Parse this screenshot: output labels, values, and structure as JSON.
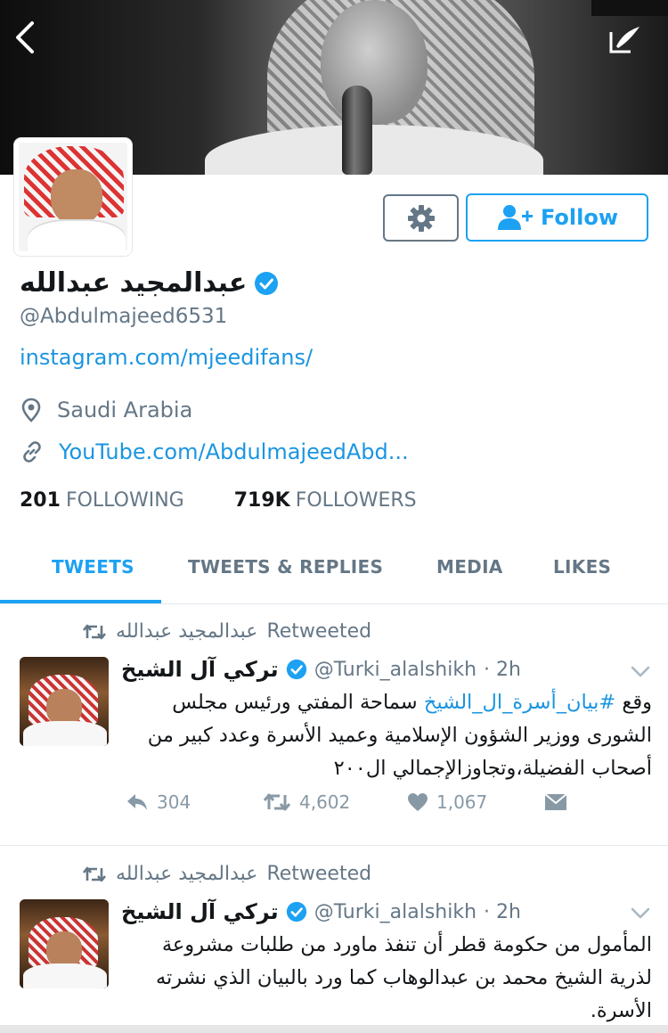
{
  "profile": {
    "name": "عبدالمجيد عبدالله",
    "handle": "@Abdulmajeed6531",
    "bio_link": "instagram.com/mjeedifans/",
    "location": "Saudi Arabia",
    "website": "YouTube.com/AbdulmajeedAbd...",
    "following_count": "201",
    "following_label": "FOLLOWING",
    "followers_count": "719K",
    "followers_label": "FOLLOWERS"
  },
  "actions": {
    "follow_label": "Follow"
  },
  "tabs": [
    {
      "label": "TWEETS",
      "active": true
    },
    {
      "label": "TWEETS & REPLIES",
      "active": false
    },
    {
      "label": "MEDIA",
      "active": false
    },
    {
      "label": "LIKES",
      "active": false
    }
  ],
  "tweets": [
    {
      "retweeted_by": "عبدالمجيد عبدالله",
      "retweeted_label": "Retweeted",
      "author_name": "تركي آل الشيخ",
      "author_handle": "@Turki_alalshikh",
      "time": "· 2h",
      "text_prefix": "وقع ",
      "hashtag": "#بيان_أسرة_ال_الشيخ",
      "text_rest": " سماحة المفتي ورئيس مجلس الشورى ووزير الشؤون الإسلامية وعميد الأسرة وعدد كبير من أصحاب الفضيلة،وتجاوزالإجمالي ال٢٠٠",
      "replies": "304",
      "retweets": "4,602",
      "likes": "1,067"
    },
    {
      "retweeted_by": "عبدالمجيد عبدالله",
      "retweeted_label": "Retweeted",
      "author_name": "تركي آل الشيخ",
      "author_handle": "@Turki_alalshikh",
      "time": "· 2h",
      "text": "المأمول من حكومة قطر أن تنفذ ماورد من طلبات مشروعة لذرية الشيخ محمد بن عبدالوهاب كما ورد بالبيان الذي نشرته الأسرة."
    }
  ],
  "colors": {
    "accent": "#1da1f2",
    "link": "#1b95e0",
    "muted": "#657786",
    "verified": "#1da1f2"
  }
}
